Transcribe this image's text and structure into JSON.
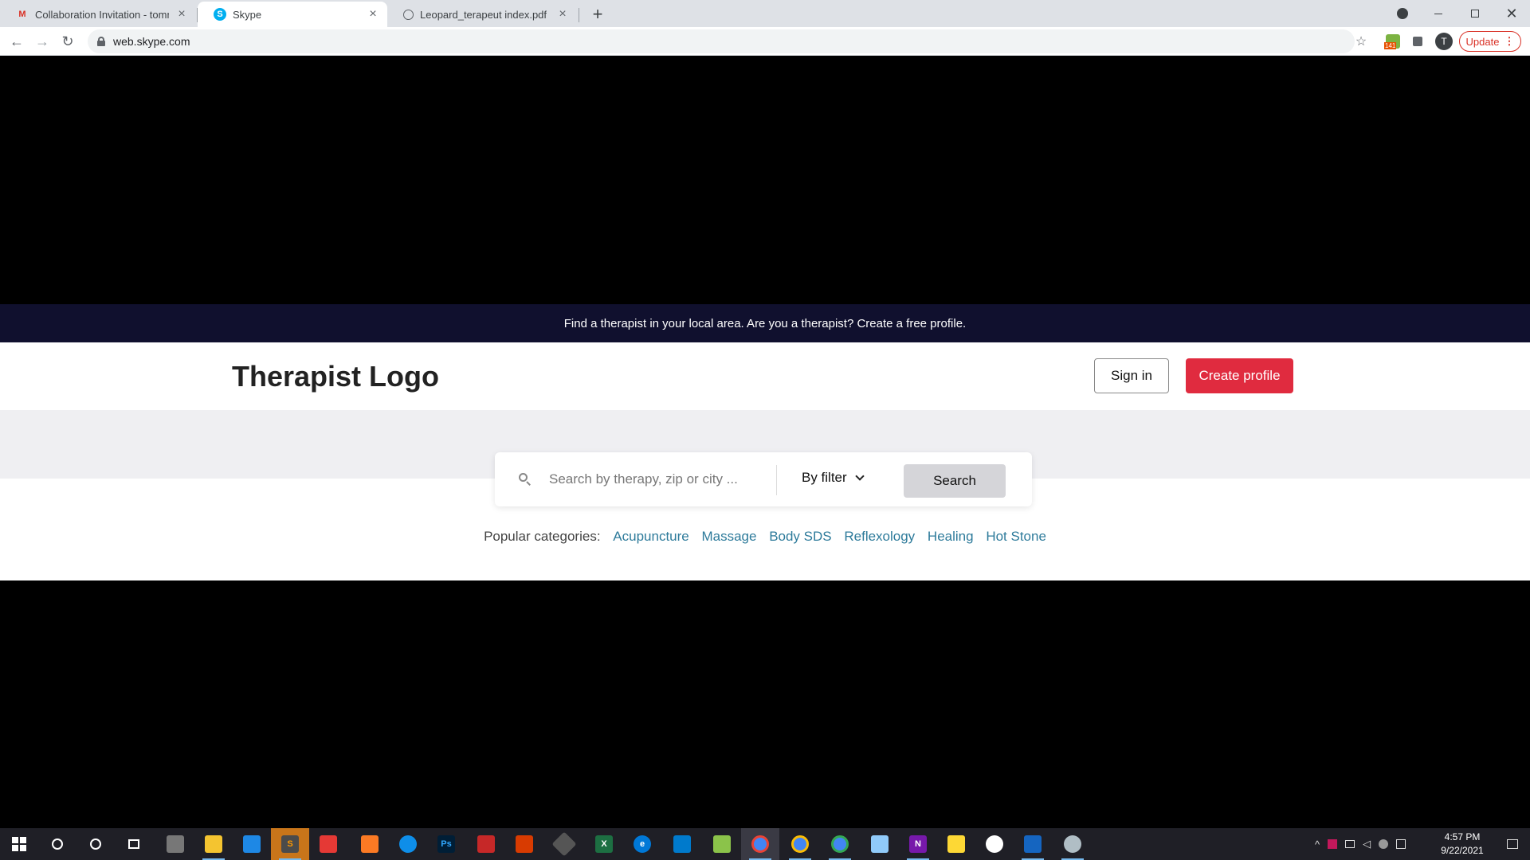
{
  "browser": {
    "tabs": [
      {
        "title": "Collaboration Invitation - tommo",
        "favicon": "gmail-icon",
        "active": false
      },
      {
        "title": "Skype",
        "favicon": "skype-icon",
        "active": true
      },
      {
        "title": "Leopard_terapeut index.pdf",
        "favicon": "globe-icon",
        "active": false
      }
    ],
    "url": "web.skype.com",
    "profile_initial": "T",
    "update_label": "Update",
    "extension_badge": "141"
  },
  "page": {
    "banner_text": "Find a therapist in your local area. Are you a therapist? Create a free profile.",
    "logo": "Therapist Logo",
    "sign_in": "Sign in",
    "create_profile": "Create profile",
    "search": {
      "placeholder": "Search by therapy, zip or city ...",
      "filter_label": "By filter",
      "button": "Search"
    },
    "popular_label": "Popular categories:",
    "categories": [
      "Acupuncture",
      "Massage",
      "Body SDS",
      "Reflexology",
      "Healing",
      "Hot Stone"
    ]
  },
  "taskbar": {
    "time": "4:57 PM",
    "date": "9/22/2021",
    "apps": [
      "file-explorer-icon",
      "mail-icon",
      "sublime-icon",
      "anydesk-icon",
      "xampp-icon",
      "teamviewer-icon",
      "photoshop-icon",
      "app-icon",
      "office-icon",
      "git-icon",
      "excel-icon",
      "edge-icon",
      "vscode-icon",
      "app-icon",
      "chrome-icon",
      "chrome-icon",
      "chrome-icon",
      "app-icon",
      "onenote-icon",
      "sticky-notes-icon",
      "app-icon",
      "photos-icon",
      "paint-icon"
    ]
  },
  "colors": {
    "banner_bg": "#10102e",
    "create_btn": "#e02b3f",
    "category_link": "#2e7b9b",
    "search_btn": "#d5d5d9"
  }
}
